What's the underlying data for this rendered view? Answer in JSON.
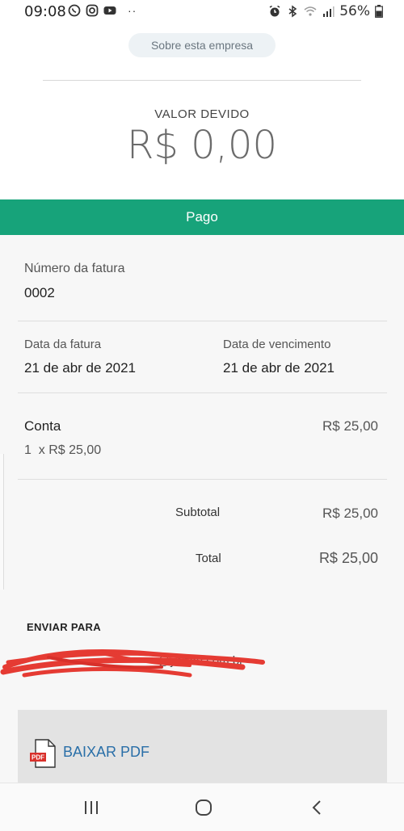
{
  "status_bar": {
    "time": "09:08",
    "dots": "··",
    "battery": "56%"
  },
  "header": {
    "about_label": "Sobre esta empresa"
  },
  "amount_due": {
    "label": "VALOR DEVIDO",
    "value": "R$ 0,00"
  },
  "status": {
    "label": "Pago",
    "color": "#17a37a"
  },
  "invoice": {
    "number_label": "Número da fatura",
    "number_value": "0002",
    "date_label": "Data da fatura",
    "date_value": "21 de abr de 2021",
    "due_label": "Data de vencimento",
    "due_value": "21 de abr de 2021"
  },
  "line_item": {
    "name": "Conta",
    "amount": "R$ 25,00",
    "qty_price": "1  x R$ 25,00"
  },
  "totals": {
    "subtotal_label": "Subtotal",
    "subtotal_value": "R$ 25,00",
    "total_label": "Total",
    "total_value": "R$ 25,00"
  },
  "send_to": {
    "title": "ENVIAR PARA",
    "email_visible_part": "@yahoo.com.br"
  },
  "download": {
    "label": "BAIXAR PDF",
    "icon_text": "PDF"
  },
  "icons": {
    "status_left": [
      "whatsapp-icon",
      "instagram-icon",
      "youtube-icon"
    ],
    "status_right": [
      "alarm-icon",
      "bluetooth-icon",
      "wifi-icon",
      "signal-icon",
      "battery-icon"
    ],
    "nav": [
      "recent-apps-icon",
      "home-icon",
      "back-icon"
    ]
  }
}
